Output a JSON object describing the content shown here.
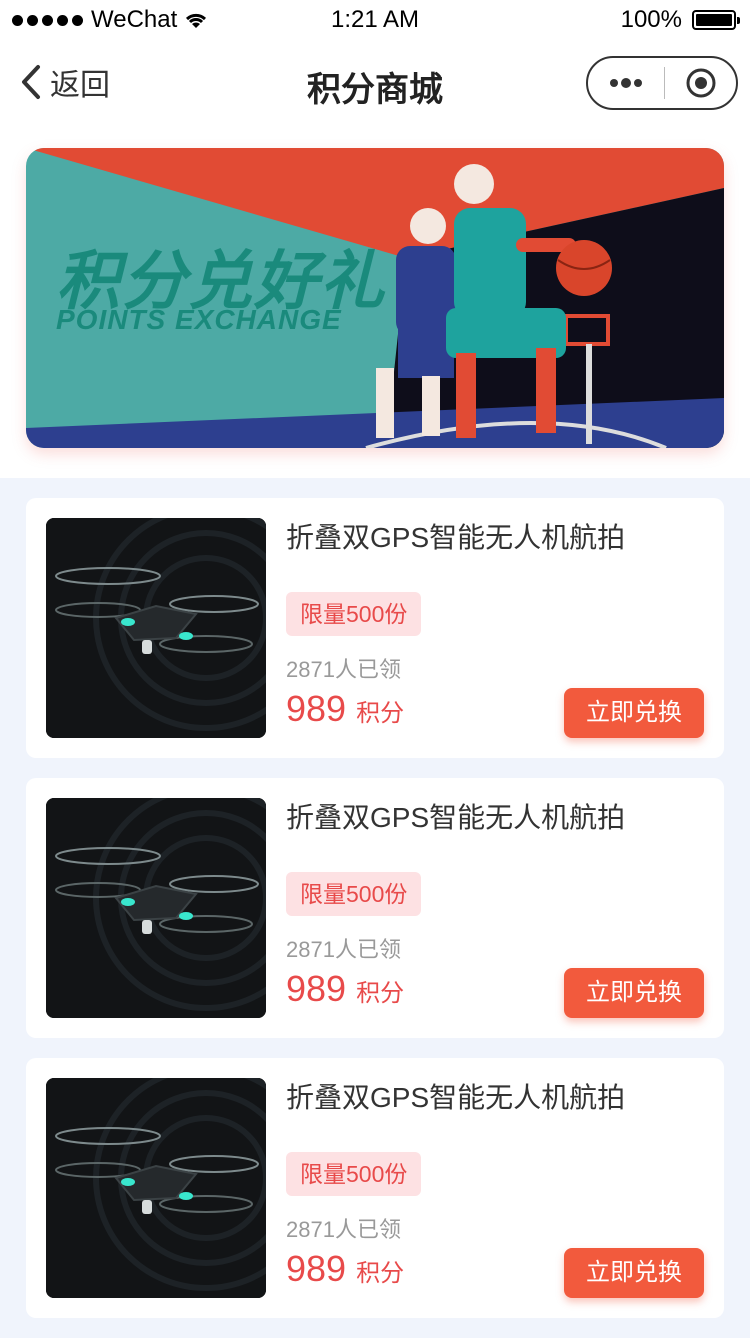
{
  "status_bar": {
    "carrier": "WeChat",
    "time": "1:21 AM",
    "battery": "100%"
  },
  "nav": {
    "back_label": "返回",
    "title": "积分商城"
  },
  "banner": {
    "title": "积分兑好礼",
    "subtitle": "POINTS EXCHANGE"
  },
  "products": [
    {
      "name": "折叠双GPS智能无人机航拍",
      "limit": "限量500份",
      "claimed": "2871人已领",
      "price": "989",
      "unit": "积分",
      "button": "立即兑换"
    },
    {
      "name": "折叠双GPS智能无人机航拍",
      "limit": "限量500份",
      "claimed": "2871人已领",
      "price": "989",
      "unit": "积分",
      "button": "立即兑换"
    },
    {
      "name": "折叠双GPS智能无人机航拍",
      "limit": "限量500份",
      "claimed": "2871人已领",
      "price": "989",
      "unit": "积分",
      "button": "立即兑换"
    }
  ],
  "colors": {
    "accent": "#f25a3d",
    "price": "#e84a4a",
    "page_bg": "#f0f4fc"
  }
}
